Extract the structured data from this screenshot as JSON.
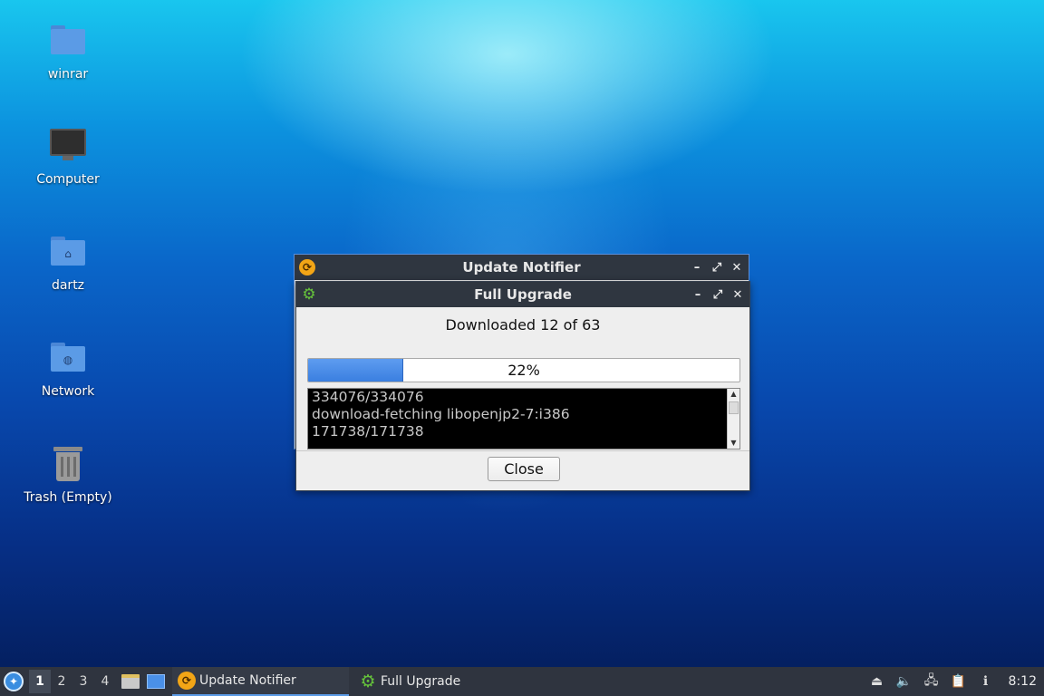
{
  "desktop": {
    "icons": [
      {
        "label": "winrar",
        "icon": "folder-icon"
      },
      {
        "label": "Computer",
        "icon": "computer-icon"
      },
      {
        "label": "dartz",
        "icon": "home-folder-icon"
      },
      {
        "label": "Network",
        "icon": "network-folder-icon"
      },
      {
        "label": "Trash (Empty)",
        "icon": "trash-icon"
      }
    ]
  },
  "windows": {
    "notifier": {
      "title": "Update Notifier",
      "icon": "update-notifier-icon",
      "controls": {
        "minimize": "–",
        "maximize": "⤢",
        "close": "✕"
      }
    },
    "upgrade": {
      "title": "Full Upgrade",
      "icon": "gear-icon",
      "controls": {
        "minimize": "–",
        "maximize": "⤢",
        "close": "✕"
      },
      "status": "Downloaded 12 of 63",
      "progress_percent": 22,
      "progress_label": "22%",
      "log_lines": [
        "334076/334076",
        "download-fetching libopenjp2-7:i386",
        "171738/171738"
      ],
      "close_label": "Close"
    }
  },
  "taskbar": {
    "workspaces": [
      "1",
      "2",
      "3",
      "4"
    ],
    "active_workspace": "1",
    "tasks": [
      {
        "label": "Update Notifier",
        "icon": "update-notifier-icon",
        "active": true
      },
      {
        "label": "Full Upgrade",
        "icon": "gear-icon",
        "active": false
      }
    ],
    "clock": "8:12"
  },
  "colors": {
    "titlebar": "#2f3640",
    "taskbar": "#2f343f",
    "progress_fill": "#3a7fe0",
    "accent": "#5b9be6"
  }
}
